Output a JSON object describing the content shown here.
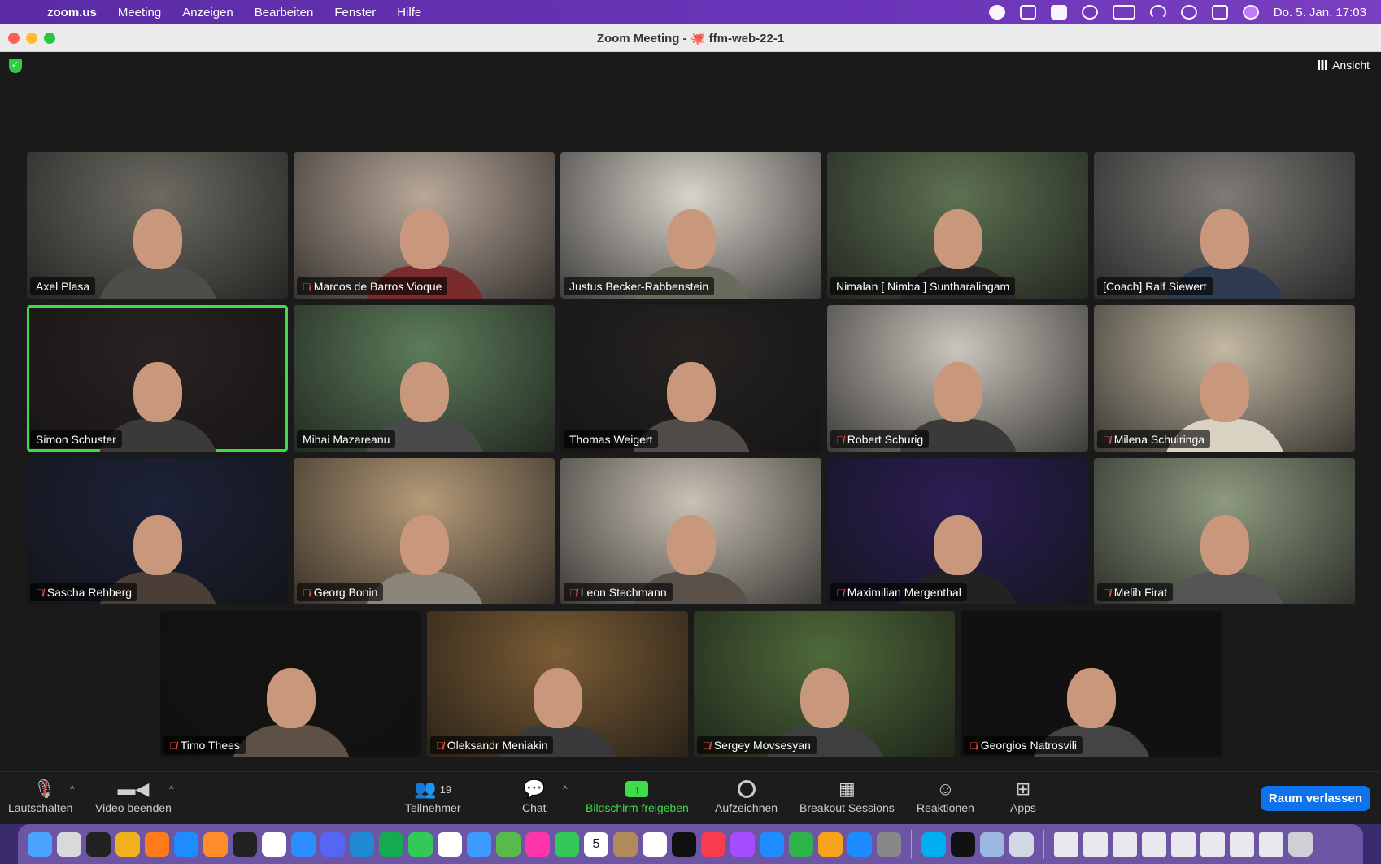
{
  "menubar": {
    "apple": "",
    "items": [
      "zoom.us",
      "Meeting",
      "Anzeigen",
      "Bearbeiten",
      "Fenster",
      "Hilfe"
    ],
    "datetime": "Do. 5. Jan. 17:03"
  },
  "window": {
    "title": "Zoom Meeting - 🐙 ffm-web-22-1",
    "view_label": "Ansicht"
  },
  "participants": [
    {
      "name": "Axel Plasa",
      "muted": false,
      "bg": "#6c6a62",
      "shirt": "#4d4d4a"
    },
    {
      "name": "Marcos de Barros Vioque",
      "muted": true,
      "bg": "#b9a89a",
      "shirt": "#7a2c2c"
    },
    {
      "name": "Justus Becker-Rabbenstein",
      "muted": false,
      "bg": "#d8d3cb",
      "shirt": "#6b6b5d"
    },
    {
      "name": "Nimalan [ Nimba ] Suntharalingam",
      "muted": false,
      "bg": "#5e7152",
      "shirt": "#2a2a2a"
    },
    {
      "name": "[Coach] Ralf Siewert",
      "muted": false,
      "bg": "#7e7b77",
      "shirt": "#2d3a50"
    },
    {
      "name": "Simon Schuster",
      "muted": false,
      "bg": "#2a2222",
      "shirt": "#3a3a3a",
      "active": true
    },
    {
      "name": "Mihai Mazareanu",
      "muted": false,
      "bg": "#5d7c5a",
      "shirt": "#4a4a4a"
    },
    {
      "name": "Thomas Weigert",
      "muted": false,
      "bg": "#262321",
      "shirt": "#504b47"
    },
    {
      "name": "Robert Schurig",
      "muted": true,
      "bg": "#cbc6bd",
      "shirt": "#3a3a3a"
    },
    {
      "name": "Milena Schuiringa",
      "muted": true,
      "bg": "#c3b9a3",
      "shirt": "#d9d1c1"
    },
    {
      "name": "Sascha Rehberg",
      "muted": true,
      "bg": "#1c2238",
      "shirt": "#4a3e36"
    },
    {
      "name": "Georg Bonin",
      "muted": true,
      "bg": "#b69b78",
      "shirt": "#8b8478"
    },
    {
      "name": "Leon Stechmann",
      "muted": true,
      "bg": "#c9c1b5",
      "shirt": "#595049"
    },
    {
      "name": "Maximilian Mergenthal",
      "muted": true,
      "bg": "#2b1e55",
      "shirt": "#222"
    },
    {
      "name": "Melih Firat",
      "muted": true,
      "bg": "#8e9a80",
      "shirt": "#555"
    },
    {
      "name": "Timo Thees",
      "muted": true,
      "bg": "#121212",
      "shirt": "#5d5045"
    },
    {
      "name": "Oleksandr Meniakin",
      "muted": true,
      "bg": "#7a5c34",
      "shirt": "#3a3a3a"
    },
    {
      "name": "Sergey Movsesyan",
      "muted": true,
      "bg": "#4f6a3a",
      "shirt": "#3f3f3f"
    },
    {
      "name": "Georgios Natrosvili",
      "muted": true,
      "bg": "#111",
      "shirt": "#444"
    }
  ],
  "toolbar": {
    "mute_label": "Lautschalten",
    "video_label": "Video beenden",
    "participants_label": "Teilnehmer",
    "participants_count": "19",
    "chat_label": "Chat",
    "share_label": "Bildschirm freigeben",
    "record_label": "Aufzeichnen",
    "breakout_label": "Breakout Sessions",
    "reactions_label": "Reaktionen",
    "apps_label": "Apps",
    "leave_label": "Raum verlassen"
  },
  "colors": {
    "active_speaker": "#3ddc4a",
    "share_green": "#3ddc4a",
    "leave_blue": "#0e72ed",
    "muted_red": "#e74c3c"
  },
  "dock": {
    "apps": [
      "finder-icon",
      "launchpad-icon",
      "terminal-icon",
      "chrome-icon",
      "firefox-icon",
      "safari-icon",
      "sublime-icon",
      "figma-icon",
      "slack-icon",
      "zoom-icon",
      "discord-icon",
      "vscode-icon",
      "mongodb-icon",
      "messages-icon",
      "notes-icon",
      "mail-icon",
      "maps-icon",
      "photos-icon",
      "facetime-icon",
      "calendar-icon",
      "contacts-icon",
      "reminders-icon",
      "tv-icon",
      "music-icon",
      "podcasts-icon",
      "keynote-icon",
      "numbers-icon",
      "pages-icon",
      "appstore-icon",
      "settings-icon",
      "skype-icon",
      "iterm-icon",
      "preview-icon",
      "quicktime-icon"
    ],
    "calendar_day": "5"
  }
}
